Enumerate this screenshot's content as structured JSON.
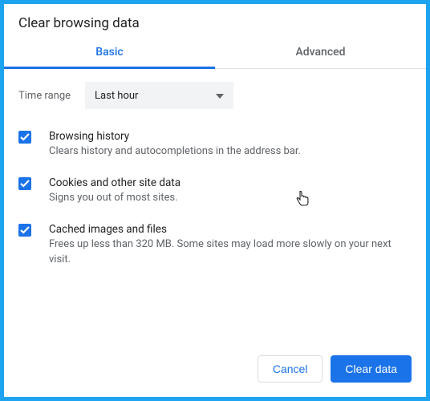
{
  "title": "Clear browsing data",
  "tabs": {
    "basic": "Basic",
    "advanced": "Advanced"
  },
  "timerange": {
    "label": "Time range",
    "value": "Last hour"
  },
  "options": [
    {
      "label": "Browsing history",
      "desc": "Clears history and autocompletions in the address bar.",
      "checked": true
    },
    {
      "label": "Cookies and other site data",
      "desc": "Signs you out of most sites.",
      "checked": true
    },
    {
      "label": "Cached images and files",
      "desc": "Frees up less than 320 MB. Some sites may load more slowly on your next visit.",
      "checked": true
    }
  ],
  "buttons": {
    "cancel": "Cancel",
    "clear": "Clear data"
  },
  "colors": {
    "accent": "#1a73e8",
    "border_outer": "#1ea3f0"
  }
}
